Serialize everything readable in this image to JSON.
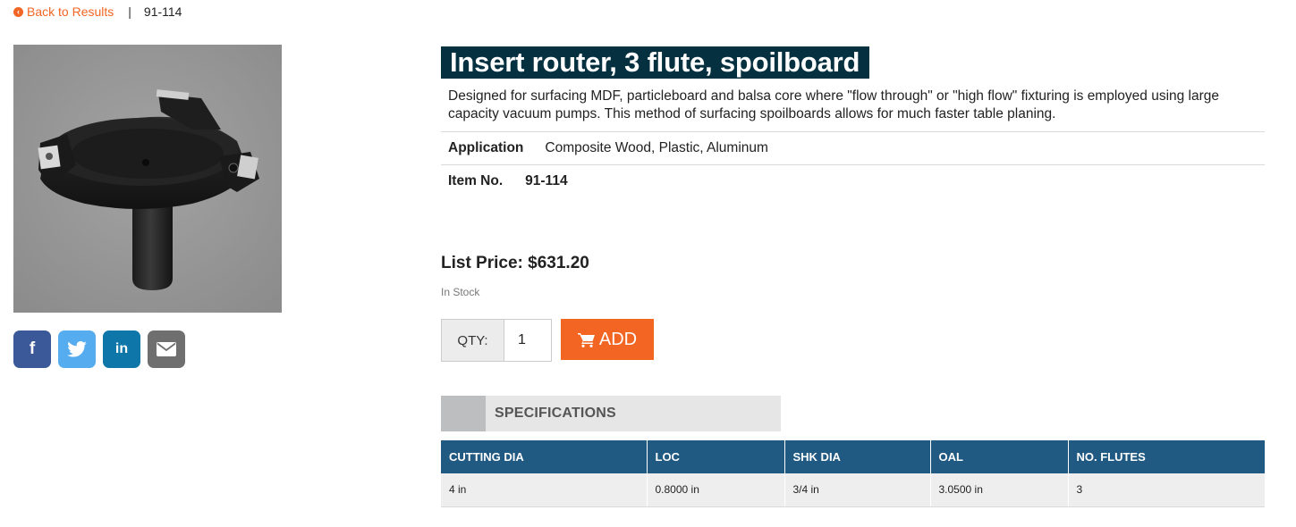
{
  "breadcrumb": {
    "back_label": "Back to Results",
    "separator": "|",
    "current": "91-114"
  },
  "product": {
    "title": "Insert router, 3 flute, spoilboard",
    "description": "Designed for surfacing MDF, particleboard and balsa core where \"flow through\" or \"high flow\" fixturing is employed using large capacity vacuum pumps. This method of surfacing spoilboards allows for much faster table planing.",
    "application_label": "Application",
    "application_value": "Composite Wood, Plastic, Aluminum",
    "item_label": "Item No.",
    "item_value": "91-114",
    "list_price": "List Price: $631.20",
    "stock_status": "In Stock"
  },
  "social": {
    "facebook": "f",
    "linkedin": "in"
  },
  "cart": {
    "qty_label": "QTY:",
    "qty_value": "1",
    "add_label": "ADD"
  },
  "specs": {
    "tab_label": "SPECIFICATIONS",
    "headers": [
      "CUTTING DIA",
      "LOC",
      "SHK DIA",
      "OAL",
      "NO. FLUTES"
    ],
    "rows": [
      [
        "4 in",
        "0.8000 in",
        "3/4 in",
        "3.0500 in",
        "3"
      ]
    ]
  },
  "colors": {
    "accent": "#f26522",
    "title_bg": "#04303f",
    "table_header": "#205981"
  },
  "icons": [
    "chevron-left-icon",
    "facebook-icon",
    "twitter-icon",
    "linkedin-icon",
    "email-icon",
    "cart-icon"
  ]
}
